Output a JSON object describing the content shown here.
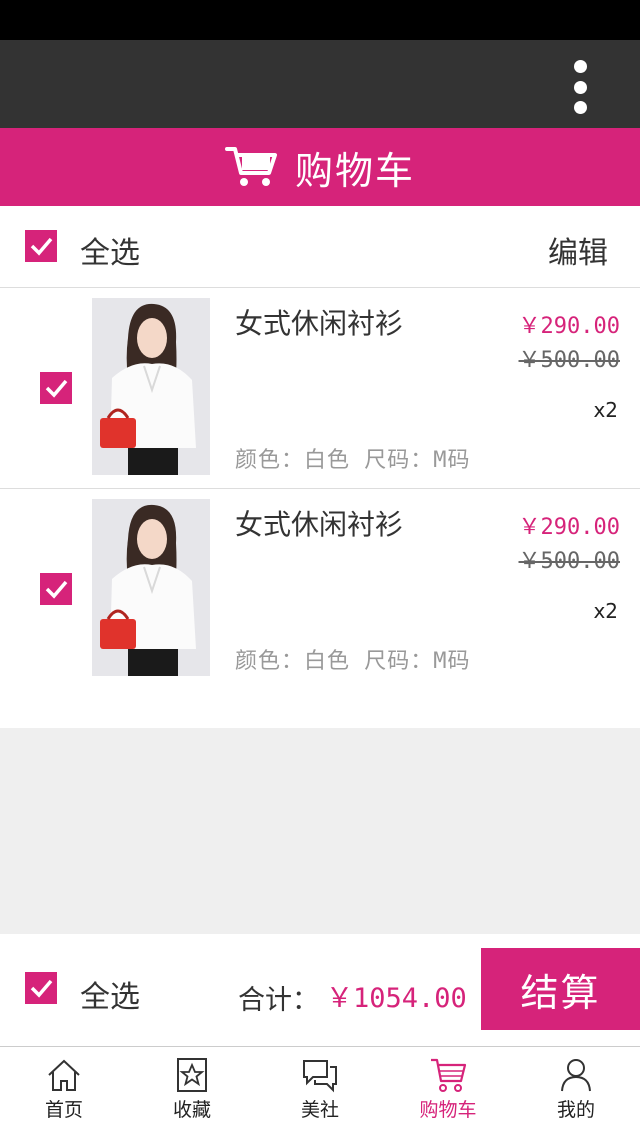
{
  "header": {
    "title": "购物车"
  },
  "colors": {
    "accent": "#d6237a",
    "app_bar": "#333333"
  },
  "select_all": {
    "label": "全选",
    "checked": true,
    "edit_label": "编辑"
  },
  "items": [
    {
      "name": "女式休闲衬衫",
      "price": "￥290.00",
      "original_price": "￥500.00",
      "quantity": "x2",
      "spec": "颜色：白色 尺码：M码",
      "checked": true
    },
    {
      "name": "女式休闲衬衫",
      "price": "￥290.00",
      "original_price": "￥500.00",
      "quantity": "x2",
      "spec": "颜色：白色 尺码：M码",
      "checked": true
    }
  ],
  "checkout": {
    "select_all_label": "全选",
    "total_label": "合计：",
    "total_value": "￥1054.00",
    "button_label": "结算"
  },
  "tabs": [
    {
      "label": "首页",
      "icon": "home-icon",
      "active": false
    },
    {
      "label": "收藏",
      "icon": "star-icon",
      "active": false
    },
    {
      "label": "美社",
      "icon": "chat-icon",
      "active": false
    },
    {
      "label": "购物车",
      "icon": "cart-icon",
      "active": true
    },
    {
      "label": "我的",
      "icon": "user-icon",
      "active": false
    }
  ]
}
